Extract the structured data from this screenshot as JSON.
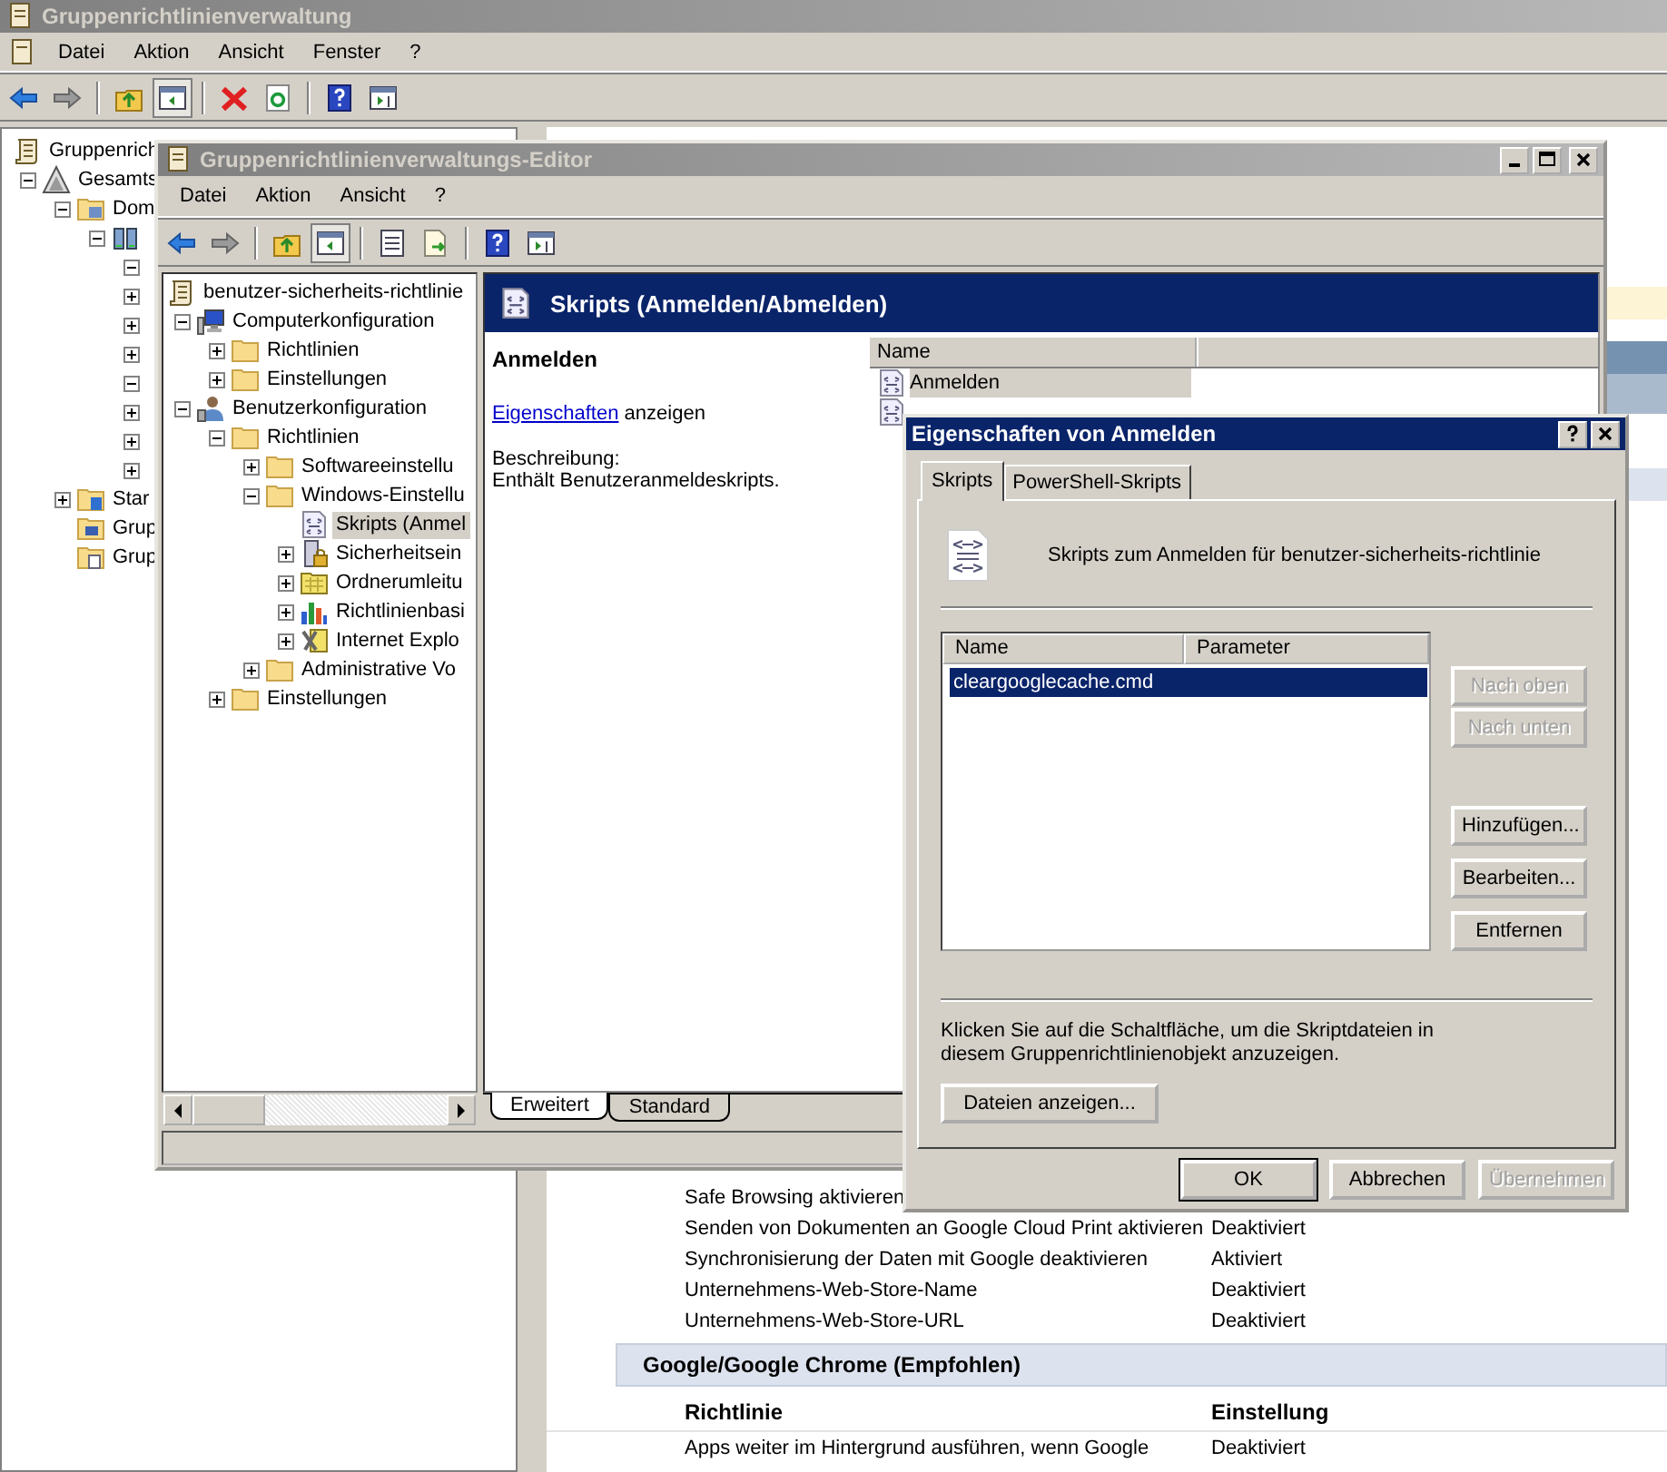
{
  "main_window": {
    "title": "Gruppenrichtlinienverwaltung",
    "menu": [
      "Datei",
      "Aktion",
      "Ansicht",
      "Fenster",
      "?"
    ],
    "tree": [
      {
        "label": "Gruppenrich",
        "kind": "scroll",
        "children": [
          {
            "label": "Gesamts",
            "kind": "forest",
            "expanded": true,
            "children": [
              {
                "label": "Dom",
                "kind": "domains",
                "expanded": true,
                "children": [
                  {
                    "kind": "servers",
                    "expanded": true,
                    "children": [
                      {
                        "expanded": true
                      },
                      {
                        "expanded": false
                      },
                      {
                        "expanded": false
                      },
                      {
                        "expanded": false
                      },
                      {
                        "expanded": true
                      },
                      {
                        "expanded": false
                      },
                      {
                        "expanded": false
                      },
                      {
                        "expanded": false
                      }
                    ]
                  }
                ]
              },
              {
                "label": "Star",
                "kind": "starter",
                "expanded": false
              },
              {
                "label": "Grup",
                "kind": "model"
              },
              {
                "label": "Grup",
                "kind": "result"
              }
            ]
          }
        ]
      }
    ],
    "report": {
      "rows_top": [
        {
          "policy": "Safe Browsing aktivieren"
        },
        {
          "policy": "Senden von Dokumenten an Google Cloud Print aktivieren",
          "setting": "Deaktiviert"
        },
        {
          "policy": "Synchronisierung der Daten mit Google deaktivieren",
          "setting": "Aktiviert"
        },
        {
          "policy": "Unternehmens-Web-Store-Name",
          "setting": "Deaktiviert"
        },
        {
          "policy": "Unternehmens-Web-Store-URL",
          "setting": "Deaktiviert"
        }
      ],
      "section": "Google/Google Chrome (Empfohlen)",
      "columns": [
        "Richtlinie",
        "Einstellung"
      ],
      "rows": [
        {
          "policy": "Apps weiter im Hintergrund ausführen, wenn Google",
          "setting": "Deaktiviert"
        }
      ]
    }
  },
  "editor": {
    "title": "Gruppenrichtlinienverwaltungs-Editor",
    "menu": [
      "Datei",
      "Aktion",
      "Ansicht",
      "?"
    ],
    "tree": [
      {
        "label": "benutzer-sicherheits-richtlinie",
        "kind": "scroll",
        "selected": false,
        "children": [
          {
            "label": "Computerkonfiguration",
            "kind": "computer",
            "expanded": true,
            "selected": false,
            "children": [
              {
                "label": "Richtlinien",
                "kind": "folder",
                "expanded": false,
                "selected": false
              },
              {
                "label": "Einstellungen",
                "kind": "folder",
                "expanded": false,
                "selected": false
              }
            ]
          },
          {
            "label": "Benutzerkonfiguration",
            "kind": "user",
            "expanded": true,
            "selected": false,
            "children": [
              {
                "label": "Richtlinien",
                "kind": "folder",
                "expanded": true,
                "selected": false,
                "children": [
                  {
                    "label": "Softwareeinstellu",
                    "kind": "folder",
                    "expanded": false,
                    "selected": false
                  },
                  {
                    "label": "Windows-Einstellu",
                    "kind": "folder",
                    "expanded": true,
                    "selected": false,
                    "children": [
                      {
                        "label": "Skripts (Anmel",
                        "kind": "script",
                        "selected": true
                      },
                      {
                        "label": "Sicherheitsein",
                        "kind": "security",
                        "expanded": false,
                        "selected": false
                      },
                      {
                        "label": "Ordnerumleitu",
                        "kind": "folder-grid",
                        "expanded": false,
                        "selected": false
                      },
                      {
                        "label": "Richtlinienbasi",
                        "kind": "chart",
                        "expanded": false,
                        "selected": false
                      },
                      {
                        "label": "Internet Explo",
                        "kind": "tools",
                        "expanded": false,
                        "selected": false
                      }
                    ]
                  },
                  {
                    "label": "Administrative Vo",
                    "kind": "folder",
                    "expanded": false,
                    "selected": false
                  }
                ]
              },
              {
                "label": "Einstellungen",
                "kind": "folder",
                "expanded": false,
                "selected": false
              }
            ]
          }
        ]
      }
    ],
    "header": "Skripts (Anmelden/Abmelden)",
    "detail": {
      "heading": "Anmelden",
      "link": "Eigenschaften",
      "link_suffix": "anzeigen",
      "description_label": "Beschreibung:",
      "description": "Enthält Benutzeranmeldeskripts."
    },
    "list": {
      "columns": [
        "Name"
      ],
      "rows": [
        {
          "label": "Anmelden",
          "selected": true
        }
      ]
    },
    "view_tabs": [
      {
        "label": "Erweitert",
        "selected": true
      },
      {
        "label": "Standard",
        "selected": false
      }
    ]
  },
  "dialog": {
    "title": "Eigenschaften von Anmelden",
    "tabs": [
      {
        "label": "Skripts",
        "selected": true
      },
      {
        "label": "PowerShell-Skripts",
        "selected": false
      }
    ],
    "caption": "Skripts zum Anmelden für benutzer-sicherheits-richtlinie",
    "list": {
      "columns": [
        "Name",
        "Parameter"
      ],
      "rows": [
        {
          "name": "cleargooglecache.cmd",
          "selected": true
        }
      ]
    },
    "order_buttons": [
      {
        "label": "Nach oben",
        "disabled": true
      },
      {
        "label": "Nach unten",
        "disabled": true
      }
    ],
    "edit_buttons": [
      {
        "label": "Hinzufügen...",
        "disabled": false
      },
      {
        "label": "Bearbeiten...",
        "disabled": false
      },
      {
        "label": "Entfernen",
        "disabled": false
      }
    ],
    "hint": "Klicken Sie auf die Schaltfläche, um die Skriptdateien in diesem Gruppenrichtlinienobjekt anzuzeigen.",
    "files_button": "Dateien anzeigen...",
    "buttons": [
      {
        "label": "OK",
        "default": true,
        "disabled": false
      },
      {
        "label": "Abbrechen",
        "default": false,
        "disabled": false
      },
      {
        "label": "Übernehmen",
        "default": false,
        "disabled": true
      }
    ]
  }
}
